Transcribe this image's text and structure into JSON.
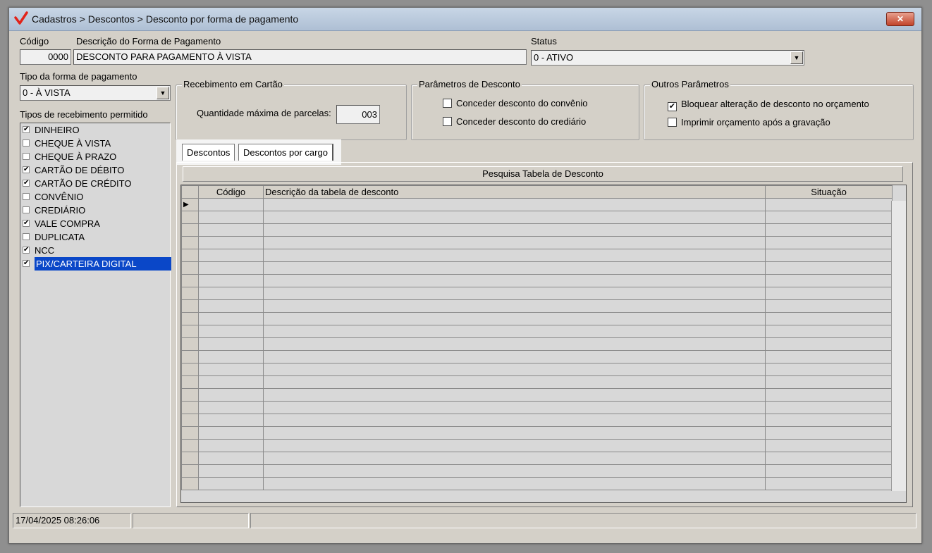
{
  "window": {
    "title": "Cadastros > Descontos > Desconto por forma de pagamento",
    "close_label": "✕",
    "accent_color": "#e2231a"
  },
  "header": {
    "codigo_label": "Código",
    "codigo_value": "0000",
    "descricao_label": "Descrição do Forma de Pagamento",
    "descricao_value": "DESCONTO PARA PAGAMENTO À VISTA",
    "status_label": "Status",
    "status_value": "0 - ATIVO"
  },
  "tipo_forma": {
    "label": "Tipo da forma de pagamento",
    "value": "0 - À VISTA"
  },
  "tipos_recebimento": {
    "label": "Tipos de recebimento permitido",
    "items": [
      {
        "label": "DINHEIRO",
        "checked": true
      },
      {
        "label": "CHEQUE À VISTA",
        "checked": false
      },
      {
        "label": "CHEQUE À PRAZO",
        "checked": false
      },
      {
        "label": "CARTÃO DE DÉBITO",
        "checked": true
      },
      {
        "label": "CARTÃO DE CRÉDITO",
        "checked": true
      },
      {
        "label": "CONVÊNIO",
        "checked": false
      },
      {
        "label": "CREDIÁRIO",
        "checked": false
      },
      {
        "label": "VALE COMPRA",
        "checked": true
      },
      {
        "label": "DUPLICATA",
        "checked": false
      },
      {
        "label": "NCC",
        "checked": true
      },
      {
        "label": "PIX/CARTEIRA DIGITAL",
        "checked": true,
        "selected": true
      }
    ]
  },
  "recebimento_cartao": {
    "title": "Recebimento em Cartão",
    "parcelas_label": "Quantidade máxima de parcelas:",
    "parcelas_value": "003"
  },
  "parametros_desconto": {
    "title": "Parâmetros de Desconto",
    "convenio_label": "Conceder desconto do convênio",
    "convenio_checked": false,
    "crediario_label": "Conceder desconto do crediário",
    "crediario_checked": false
  },
  "outros_parametros": {
    "title": "Outros Parâmetros",
    "bloquear_label": "Bloquear alteração de desconto no orçamento",
    "bloquear_checked": true,
    "imprimir_label": "Imprimir orçamento após a gravação",
    "imprimir_checked": false
  },
  "tabs": [
    {
      "label": "Descontos",
      "active": true
    },
    {
      "label": "Descontos por cargo",
      "active": false
    }
  ],
  "grid": {
    "title": "Pesquisa Tabela de Desconto",
    "columns": [
      "Código",
      "Descrição da tabela de desconto",
      "Situação"
    ],
    "row_indicator": "▶",
    "empty_rows": 23
  },
  "statusbar": {
    "datetime": "17/04/2025 08:26:06",
    "cell2": "",
    "cell3": ""
  }
}
